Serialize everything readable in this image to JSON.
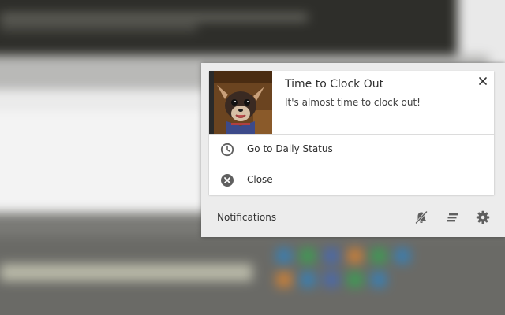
{
  "notification": {
    "title": "Time to Clock Out",
    "message": "It's almost time to clock out!",
    "thumbnail_icon": "dog-photo",
    "close_icon": "close-icon",
    "actions": [
      {
        "label": "Go to Daily Status",
        "icon": "clock-icon"
      },
      {
        "label": "Close",
        "icon": "close-circle-icon"
      }
    ]
  },
  "footer": {
    "label": "Notifications",
    "buttons": [
      {
        "icon": "mute-bell-icon"
      },
      {
        "icon": "clear-all-icon"
      },
      {
        "icon": "gear-icon"
      }
    ]
  },
  "colors": {
    "panel_bg": "#ececec",
    "card_bg": "#ffffff",
    "text": "#303030",
    "icon": "#5f5f5f"
  }
}
